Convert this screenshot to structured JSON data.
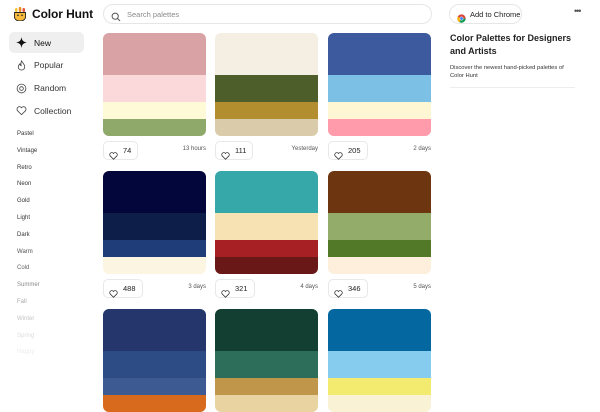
{
  "app": {
    "title": "Color Hunt"
  },
  "search": {
    "placeholder": "Search palettes",
    "value": ""
  },
  "chrome_button": {
    "label": "Add to Chrome"
  },
  "more_menu": {
    "label": "•••"
  },
  "nav": {
    "items": [
      {
        "label": "New",
        "icon": "sparkle-icon",
        "active": true
      },
      {
        "label": "Popular",
        "icon": "flame-icon",
        "active": false
      },
      {
        "label": "Random",
        "icon": "random-icon",
        "active": false
      },
      {
        "label": "Collection",
        "icon": "heart-icon",
        "active": false
      }
    ]
  },
  "tags": {
    "items": [
      {
        "label": "Pastel",
        "color": "#333333"
      },
      {
        "label": "Vintage",
        "color": "#333333"
      },
      {
        "label": "Retro",
        "color": "#333333"
      },
      {
        "label": "Neon",
        "color": "#333333"
      },
      {
        "label": "Gold",
        "color": "#333333"
      },
      {
        "label": "Light",
        "color": "#333333"
      },
      {
        "label": "Dark",
        "color": "#333333"
      },
      {
        "label": "Warm",
        "color": "#555555"
      },
      {
        "label": "Cold",
        "color": "#666666"
      },
      {
        "label": "Summer",
        "color": "#8a8a8a"
      },
      {
        "label": "Fall",
        "color": "#a9a9a9"
      },
      {
        "label": "Winter",
        "color": "#c4c4c4"
      },
      {
        "label": "Spring",
        "color": "#dcdcdc"
      },
      {
        "label": "Happy",
        "color": "#ececec"
      }
    ]
  },
  "palettes": [
    {
      "colors": [
        "#D9A3A5",
        "#FBD9DB",
        "#FEF9D7",
        "#8FA96A"
      ],
      "likes": "74",
      "date": "13 hours"
    },
    {
      "colors": [
        "#F4EEE3",
        "#4E5E2A",
        "#B38E2E",
        "#DACCAB"
      ],
      "likes": "111",
      "date": "Yesterday"
    },
    {
      "colors": [
        "#3E5A9E",
        "#7CC0E6",
        "#FFF6D3",
        "#FF9BAA"
      ],
      "likes": "205",
      "date": "2 days"
    },
    {
      "colors": [
        "#03063B",
        "#0D1F49",
        "#1F3D79",
        "#FCF5E2"
      ],
      "likes": "488",
      "date": "3 days"
    },
    {
      "colors": [
        "#36A8A9",
        "#F6E2B3",
        "#A62024",
        "#6A1717"
      ],
      "likes": "321",
      "date": "4 days"
    },
    {
      "colors": [
        "#6D3610",
        "#93AC69",
        "#517927",
        "#FDEFDB"
      ],
      "likes": "346",
      "date": "5 days"
    },
    {
      "colors": [
        "#24366B",
        "#2D4C86",
        "#3D5B92",
        "#D86A1E"
      ],
      "likes": "",
      "date": ""
    },
    {
      "colors": [
        "#123F31",
        "#2D6E5B",
        "#C0964A",
        "#E9D4A1"
      ],
      "likes": "",
      "date": ""
    },
    {
      "colors": [
        "#04679F",
        "#86CCEF",
        "#F3EB6F",
        "#F9F2D4"
      ],
      "likes": "",
      "date": ""
    }
  ],
  "promo": {
    "title": "Color Palettes for Designers and Artists",
    "description": "Discover the newest hand-picked palettes of Color Hunt"
  }
}
